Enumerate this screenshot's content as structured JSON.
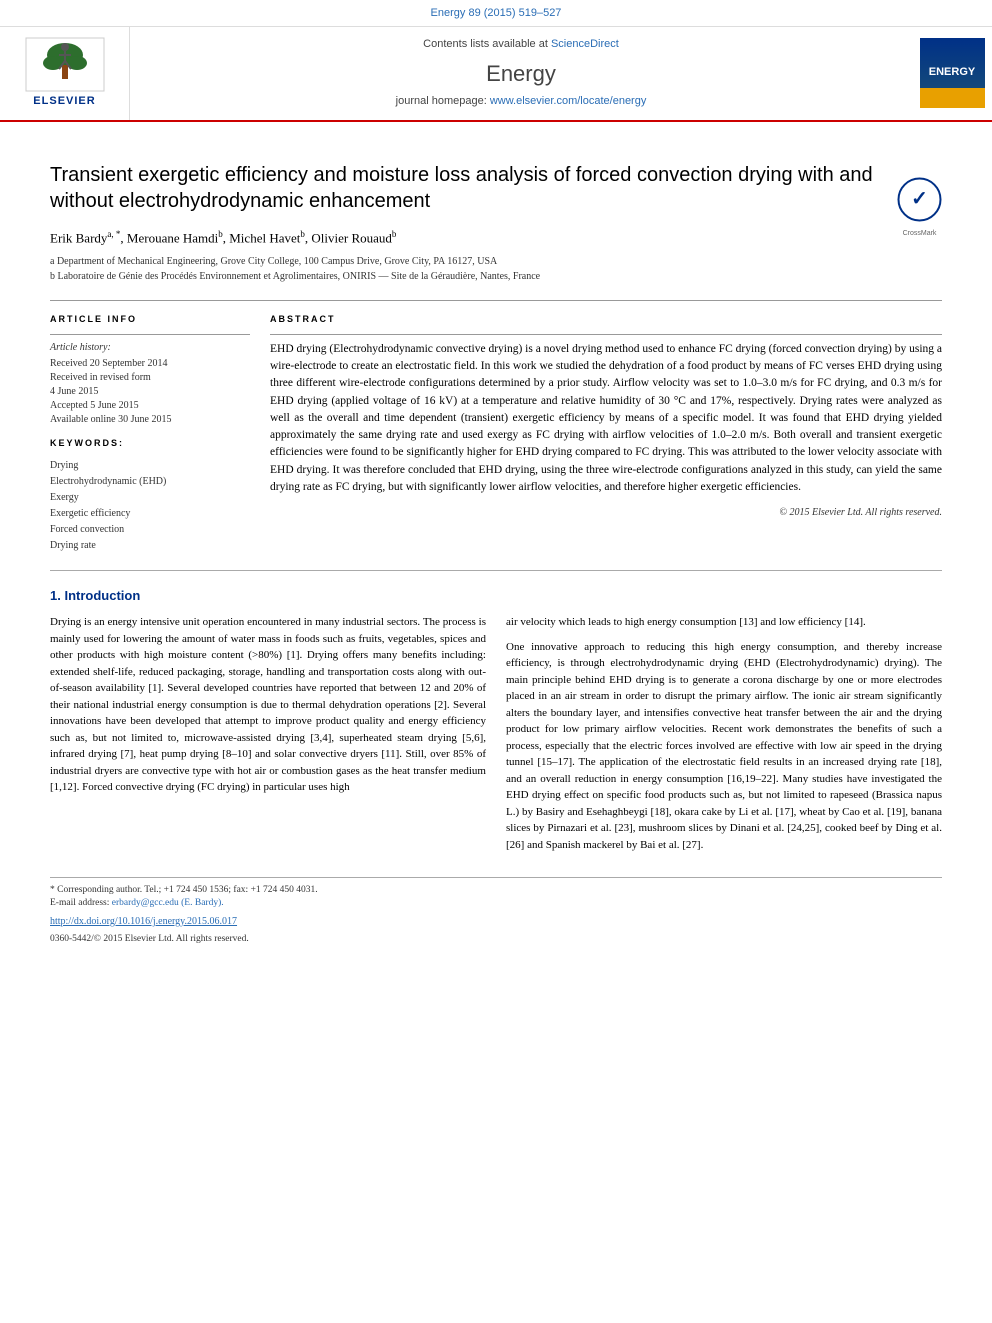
{
  "topbar": {
    "journal_ref": "Energy 89 (2015) 519–527"
  },
  "header": {
    "sciencedirect_text": "Contents lists available at",
    "sciencedirect_link": "ScienceDirect",
    "journal_name": "Energy",
    "homepage_text": "journal homepage:",
    "homepage_url": "www.elsevier.com/locate/energy",
    "elsevier_label": "ELSEVIER"
  },
  "article": {
    "title": "Transient exergetic efficiency and moisture loss analysis of forced convection drying with and without electrohydrodynamic enhancement",
    "authors": "Erik Bardy a, *, Merouane Hamdi b, Michel Havet b, Olivier Rouaud b",
    "affiliation_a": "a Department of Mechanical Engineering, Grove City College, 100 Campus Drive, Grove City, PA 16127, USA",
    "affiliation_b": "b Laboratoire de Génie des Procédés Environnement et Agrolimentaires, ONIRIS — Site de la Géraudière, Nantes, France"
  },
  "article_info": {
    "section_label": "ARTICLE INFO",
    "history_label": "Article history:",
    "received": "Received 20 September 2014",
    "received_revised": "Received in revised form 4 June 2015",
    "accepted": "Accepted 5 June 2015",
    "available": "Available online 30 June 2015",
    "keywords_label": "Keywords:",
    "keywords": [
      "Drying",
      "Electrohydrodynamic (EHD)",
      "Exergy",
      "Exergetic efficiency",
      "Forced convection",
      "Drying rate"
    ]
  },
  "abstract": {
    "section_label": "ABSTRACT",
    "text": "EHD drying (Electrohydrodynamic convective drying) is a novel drying method used to enhance FC drying (forced convection drying) by using a wire-electrode to create an electrostatic field. In this work we studied the dehydration of a food product by means of FC verses EHD drying using three different wire-electrode configurations determined by a prior study. Airflow velocity was set to 1.0–3.0 m/s for FC drying, and 0.3 m/s for EHD drying (applied voltage of 16 kV) at a temperature and relative humidity of 30 °C and 17%, respectively. Drying rates were analyzed as well as the overall and time dependent (transient) exergetic efficiency by means of a specific model. It was found that EHD drying yielded approximately the same drying rate and used exergy as FC drying with airflow velocities of 1.0–2.0 m/s. Both overall and transient exergetic efficiencies were found to be significantly higher for EHD drying compared to FC drying. This was attributed to the lower velocity associate with EHD drying. It was therefore concluded that EHD drying, using the three wire-electrode configurations analyzed in this study, can yield the same drying rate as FC drying, but with significantly lower airflow velocities, and therefore higher exergetic efficiencies.",
    "copyright": "© 2015 Elsevier Ltd. All rights reserved."
  },
  "intro": {
    "section_number": "1.",
    "section_title": "Introduction",
    "left_para1": "Drying is an energy intensive unit operation encountered in many industrial sectors. The process is mainly used for lowering the amount of water mass in foods such as fruits, vegetables, spices and other products with high moisture content (>80%) [1]. Drying offers many benefits including: extended shelf-life, reduced packaging, storage, handling and transportation costs along with out-of-season availability [1]. Several developed countries have reported that between 12 and 20% of their national industrial energy consumption is due to thermal dehydration operations [2]. Several innovations have been developed that attempt to improve product quality and energy efficiency such as, but not limited to, microwave-assisted drying [3,4], superheated steam drying [5,6], infrared drying [7], heat pump drying [8–10] and solar convective dryers [11]. Still, over 85% of industrial dryers are convective type with hot air or combustion gases as the heat transfer medium [1,12]. Forced convective drying (FC drying) in particular uses high",
    "right_para1": "air velocity which leads to high energy consumption [13] and low efficiency [14].",
    "right_para2": "One innovative approach to reducing this high energy consumption, and thereby increase efficiency, is through electrohydrodynamic drying (EHD (Electrohydrodynamic) drying). The main principle behind EHD drying is to generate a corona discharge by one or more electrodes placed in an air stream in order to disrupt the primary airflow. The ionic air stream significantly alters the boundary layer, and intensifies convective heat transfer between the air and the drying product for low primary airflow velocities. Recent work demonstrates the benefits of such a process, especially that the electric forces involved are effective with low air speed in the drying tunnel [15–17]. The application of the electrostatic field results in an increased drying rate [18], and an overall reduction in energy consumption [16,19–22]. Many studies have investigated the EHD drying effect on specific food products such as, but not limited to rapeseed (Brassica napus L.) by Basiry and Esehaghbeygi [18], okara cake by Li et al. [17], wheat by Cao et al. [19], banana slices by Pirnazari et al. [23], mushroom slices by Dinani et al. [24,25], cooked beef by Ding et al.[26] and Spanish mackerel by Bai et al. [27]."
  },
  "footer": {
    "footnote_star": "* Corresponding author. Tel.; +1 724 450 1536; fax: +1 724 450 4031.",
    "email_label": "E-mail address:",
    "email": "erbardy@gcc.edu (E. Bardy).",
    "doi_url": "http://dx.doi.org/10.1016/j.energy.2015.06.017",
    "issn": "0360-5442/© 2015 Elsevier Ltd. All rights reserved."
  }
}
